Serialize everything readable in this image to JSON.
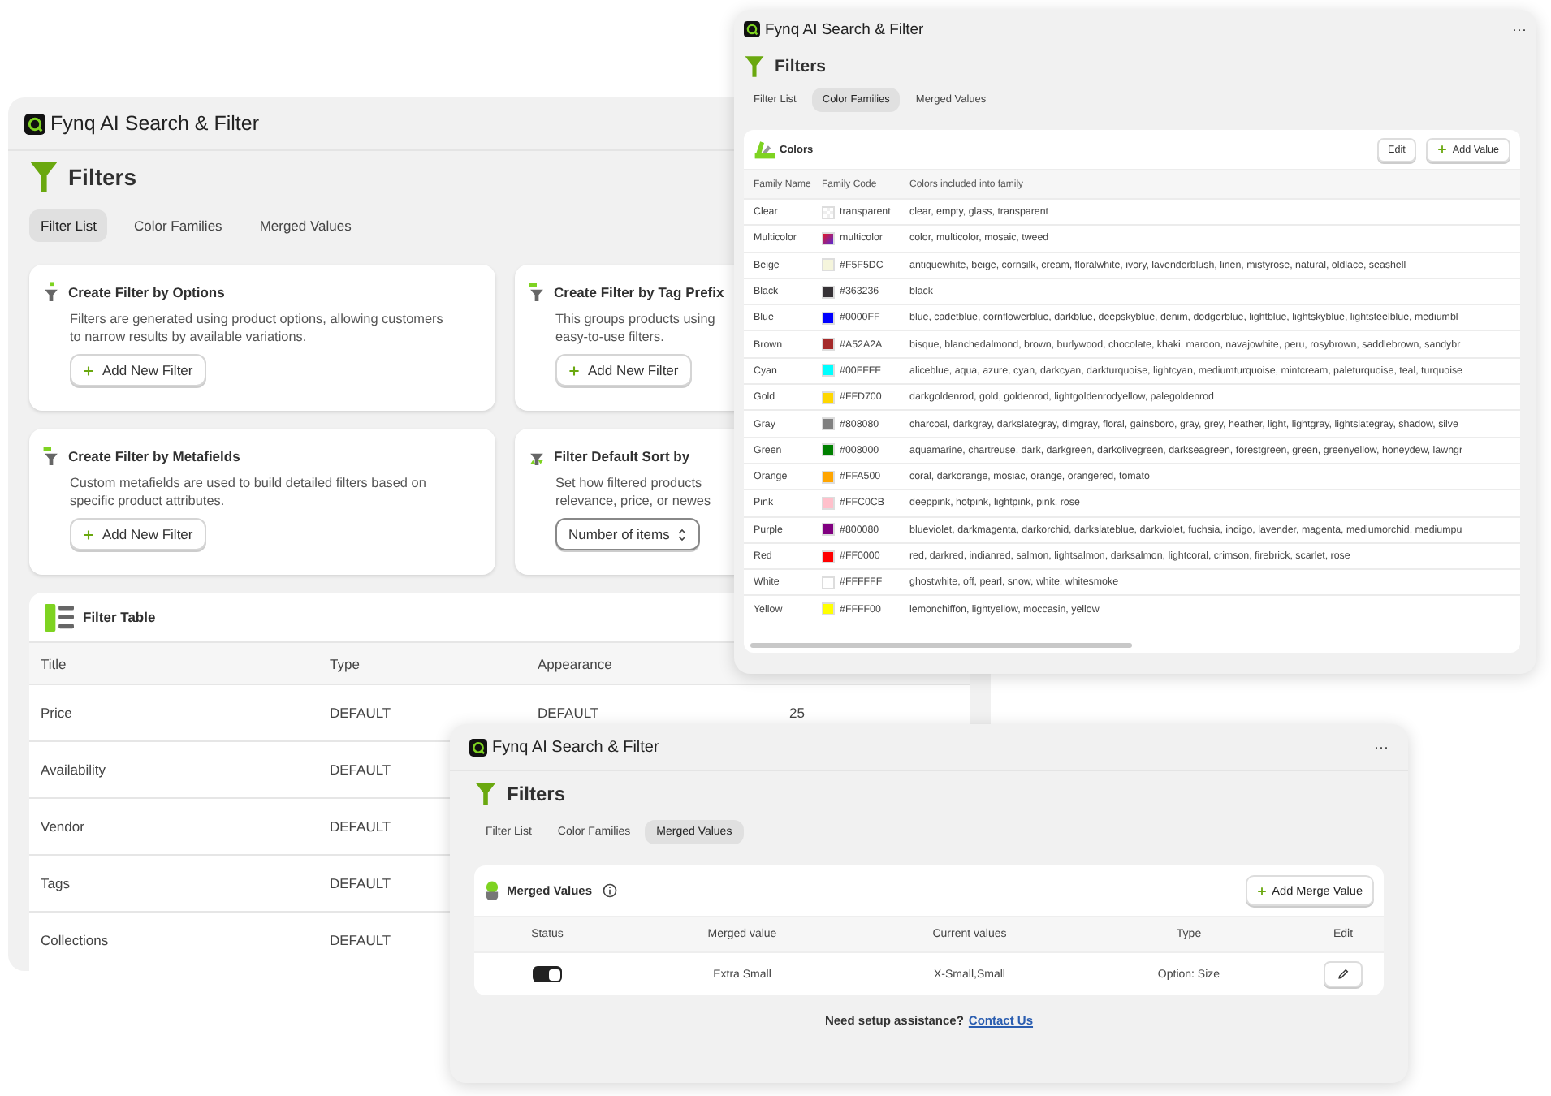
{
  "filter_list_window": {
    "title": "Fynq AI Search & Filter",
    "heading": "Filters",
    "tabs": [
      {
        "label": "Filter List",
        "selected": true
      },
      {
        "label": "Color Families",
        "selected": false
      },
      {
        "label": "Merged Values",
        "selected": false
      }
    ],
    "cards": [
      {
        "kind": "options",
        "title": "Create Filter by Options",
        "description_lines": [
          "Filters are generated using product options, allowing customers",
          "to narrow results by available variations."
        ],
        "action": {
          "kind": "button",
          "label": "Add New Filter"
        }
      },
      {
        "kind": "tags",
        "title": "Create Filter by Tag Prefix",
        "description_lines": [
          "This groups products using",
          "easy-to-use filters."
        ],
        "action": {
          "kind": "button",
          "label": "Add New Filter"
        }
      },
      {
        "kind": "metafields",
        "title": "Create Filter by Metafields",
        "description_lines": [
          "Custom metafields are used to build detailed filters based on",
          "specific product attributes."
        ],
        "action": {
          "kind": "button",
          "label": "Add New Filter"
        }
      },
      {
        "kind": "sort",
        "title": "Filter Default Sort by",
        "description_lines": [
          "Set how filtered products",
          "relevance, price, or newes"
        ],
        "action": {
          "kind": "select",
          "label": "Number of items"
        }
      }
    ],
    "filter_table": {
      "title": "Filter Table",
      "columns": [
        "Title",
        "Type",
        "Appearance"
      ],
      "rows": [
        {
          "title": "Price",
          "type": "DEFAULT",
          "appearance": "DEFAULT",
          "column_4": "25"
        },
        {
          "title": "Availability",
          "type": "DEFAULT"
        },
        {
          "title": "Vendor",
          "type": "DEFAULT"
        },
        {
          "title": "Tags",
          "type": "DEFAULT"
        },
        {
          "title": "Collections",
          "type": "DEFAULT"
        }
      ]
    }
  },
  "color_families_window": {
    "title": "Fynq AI Search & Filter",
    "menu": "···",
    "heading": "Filters",
    "tabs": [
      {
        "label": "Filter List",
        "selected": false
      },
      {
        "label": "Color Families",
        "selected": true
      },
      {
        "label": "Merged Values",
        "selected": false
      }
    ],
    "card_title": "Colors",
    "buttons": [
      {
        "kind": "plain",
        "label": "Edit"
      },
      {
        "kind": "add",
        "label": "Add Value"
      }
    ],
    "columns": [
      "Family Name",
      "Family Code",
      "Colors included into family"
    ],
    "rows": [
      {
        "name": "Clear",
        "kind": "transparent",
        "code": "transparent",
        "colors": "clear, empty, glass, transparent"
      },
      {
        "name": "Multicolor",
        "kind": "gradient",
        "code": "multicolor",
        "colors": "color, multicolor, mosaic, tweed"
      },
      {
        "name": "Beige",
        "kind": "solid",
        "color": "#f5f5dc",
        "code": "#F5F5DC",
        "colors": "antiquewhite, beige, cornsilk, cream, floralwhite, ivory, lavenderblush, linen, mistyrose, natural, oldlace, seashell"
      },
      {
        "name": "Black",
        "kind": "solid",
        "color": "#363236",
        "code": "#363236",
        "colors": "black"
      },
      {
        "name": "Blue",
        "kind": "solid",
        "color": "#0000ff",
        "code": "#0000FF",
        "colors": "blue, cadetblue, cornflowerblue, darkblue, deepskyblue, denim, dodgerblue, lightblue, lightskyblue, lightsteelblue, mediumbl"
      },
      {
        "name": "Brown",
        "kind": "solid",
        "color": "#a52a2a",
        "code": "#A52A2A",
        "colors": "bisque, blanchedalmond, brown, burlywood, chocolate, khaki, maroon, navajowhite, peru, rosybrown, saddlebrown, sandybr"
      },
      {
        "name": "Cyan",
        "kind": "solid",
        "color": "#00ffff",
        "code": "#00FFFF",
        "colors": "aliceblue, aqua, azure, cyan, darkcyan, darkturquoise, lightcyan, mediumturquoise, mintcream, paleturquoise, teal, turquoise"
      },
      {
        "name": "Gold",
        "kind": "solid",
        "color": "#ffd700",
        "code": "#FFD700",
        "colors": "darkgoldenrod, gold, goldenrod, lightgoldenrodyellow, palegoldenrod"
      },
      {
        "name": "Gray",
        "kind": "solid",
        "color": "#808080",
        "code": "#808080",
        "colors": "charcoal, darkgray, darkslategray, dimgray, floral, gainsboro, gray, grey, heather, light, lightgray, lightslategray, shadow, silve"
      },
      {
        "name": "Green",
        "kind": "solid",
        "color": "#008000",
        "code": "#008000",
        "colors": "aquamarine, chartreuse, dark, darkgreen, darkolivegreen, darkseagreen, forestgreen, green, greenyellow, honeydew, lawngr"
      },
      {
        "name": "Orange",
        "kind": "solid",
        "color": "#ffa500",
        "code": "#FFA500",
        "colors": "coral, darkorange, mosiac, orange, orangered, tomato"
      },
      {
        "name": "Pink",
        "kind": "solid",
        "color": "#ffc0cb",
        "code": "#FFC0CB",
        "colors": "deeppink, hotpink, lightpink, pink, rose"
      },
      {
        "name": "Purple",
        "kind": "solid",
        "color": "#800080",
        "code": "#800080",
        "colors": "blueviolet, darkmagenta, darkorchid, darkslateblue, darkviolet, fuchsia, indigo, lavender, magenta, mediumorchid, mediumpu"
      },
      {
        "name": "Red",
        "kind": "solid",
        "color": "#ff0000",
        "code": "#FF0000",
        "colors": "red, darkred, indianred, salmon, lightsalmon, darksalmon, lightcoral, crimson, firebrick, scarlet, rose"
      },
      {
        "name": "White",
        "kind": "solid",
        "color": "#ffffff",
        "code": "#FFFFFF",
        "colors": "ghostwhite, off, pearl, snow, white, whitesmoke"
      },
      {
        "name": "Yellow",
        "kind": "solid",
        "color": "#ffff00",
        "code": "#FFFF00",
        "colors": "lemonchiffon, lightyellow, moccasin, yellow"
      }
    ]
  },
  "merged_values_window": {
    "title": "Fynq AI Search & Filter",
    "menu": "···",
    "heading": "Filters",
    "tabs": [
      {
        "label": "Filter List",
        "selected": false
      },
      {
        "label": "Color Families",
        "selected": false
      },
      {
        "label": "Merged Values",
        "selected": true
      }
    ],
    "card_title": "Merged Values",
    "add_button": "Add Merge Value",
    "columns": [
      "Status",
      "Merged value",
      "Current values",
      "Type",
      "Edit"
    ],
    "rows": [
      {
        "on": true,
        "merged_value": "Extra Small",
        "current_values": "X-Small,Small",
        "type": "Option: Size"
      }
    ],
    "help_text": "Need setup assistance?",
    "help_link": "Contact Us"
  }
}
